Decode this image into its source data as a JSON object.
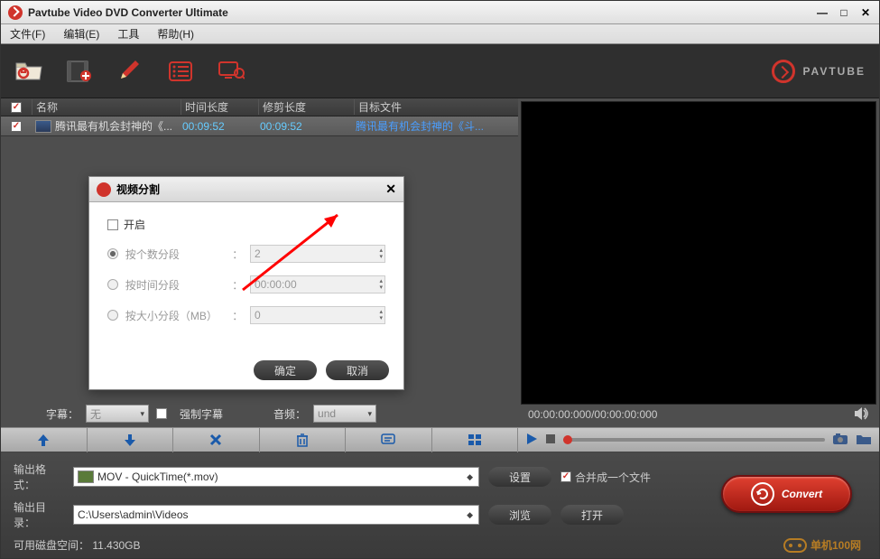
{
  "title": "Pavtube Video DVD Converter Ultimate",
  "menu": {
    "file": "文件(F)",
    "edit": "编辑(E)",
    "tool": "工具",
    "help": "帮助(H)"
  },
  "brand": "PAVTUBE",
  "headers": {
    "name": "名称",
    "duration": "时间长度",
    "trim": "修剪长度",
    "target": "目标文件"
  },
  "row": {
    "name": "腾讯最有机会封神的《...",
    "duration": "00:09:52",
    "trim": "00:09:52",
    "target": "腾讯最有机会封神的《斗..."
  },
  "dialog": {
    "title": "视频分割",
    "enable": "开启",
    "byCount": "按个数分段",
    "byTime": "按时间分段",
    "bySize": "按大小分段（MB）",
    "colon": "：",
    "countVal": "2",
    "timeVal": "00:00:00",
    "sizeVal": "0",
    "ok": "确定",
    "cancel": "取消"
  },
  "subtitle": {
    "label": "字幕：",
    "forced": "强制字幕",
    "audio": "音频：",
    "subVal": "无",
    "audVal": "und"
  },
  "preview": {
    "time": "00:00:00:000/00:00:00:000"
  },
  "output": {
    "formatLabel": "输出格式：",
    "formatVal": "MOV - QuickTime(*.mov)",
    "settings": "设置",
    "merge": "合并成一个文件",
    "dirLabel": "输出目录：",
    "dirVal": "C:\\Users\\admin\\Videos",
    "browse": "浏览",
    "open": "打开",
    "diskLabel": "可用磁盘空间：",
    "diskVal": "11.430GB"
  },
  "convert": "Convert",
  "watermark": "单机100网"
}
